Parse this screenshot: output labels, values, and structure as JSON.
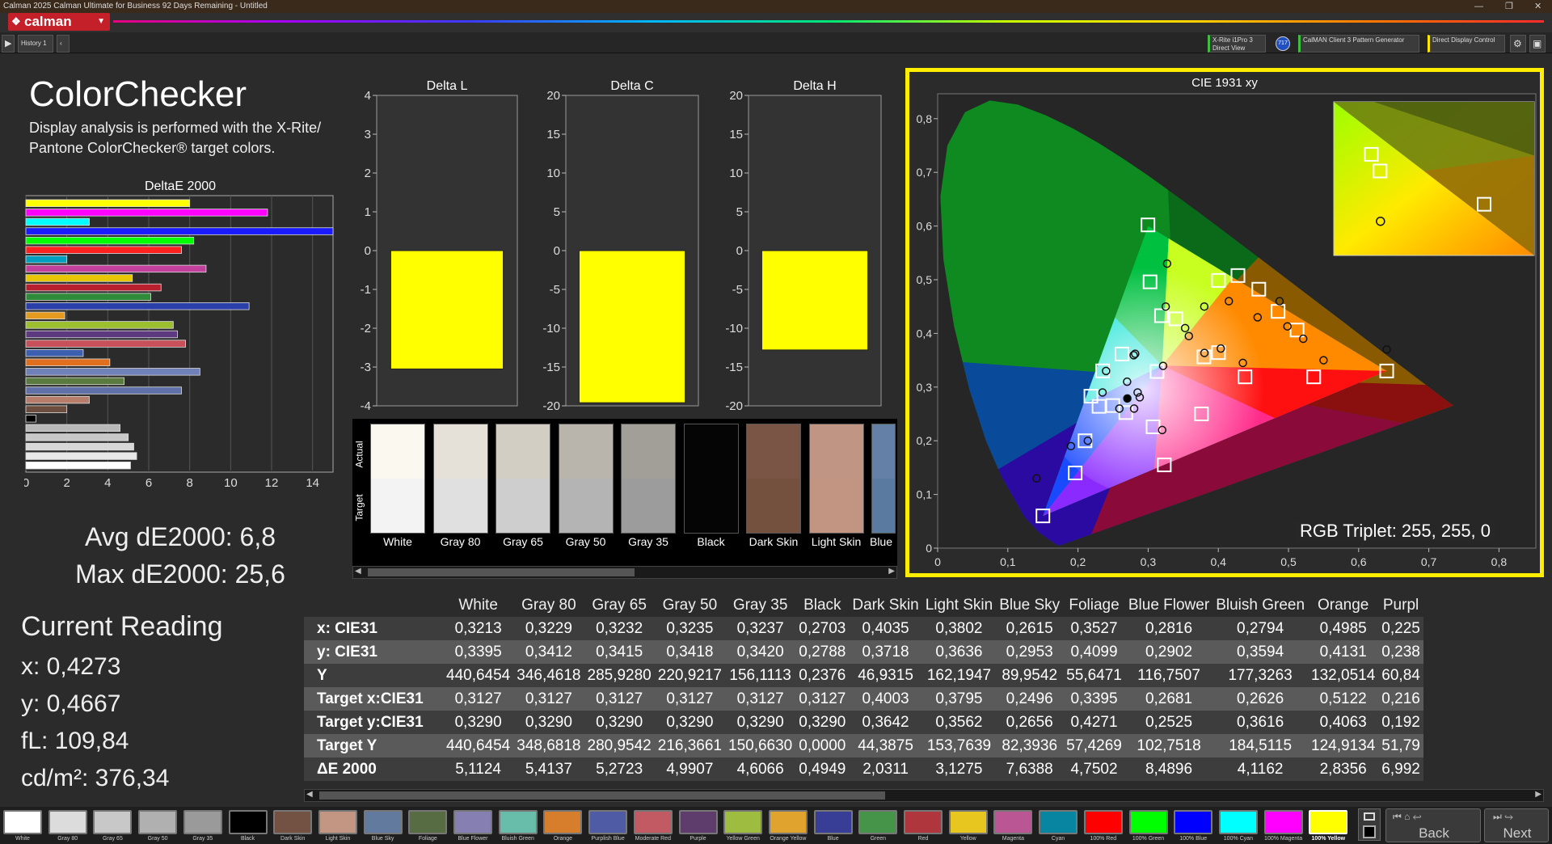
{
  "window": {
    "title": "Calman 2025 Calman Ultimate for Business 92 Days Remaining  - Untitled"
  },
  "logo": {
    "text": "calman"
  },
  "toolbar": {
    "history_label": "History 1",
    "device1": "X-Rite i1Pro 3\nDirect View",
    "device1_badge": "717",
    "device2": "CalMAN Client 3 Pattern Generator",
    "device3": "Direct Display Control"
  },
  "page": {
    "title": "ColorChecker",
    "subtitle_line1": "Display analysis is performed with the X-Rite/",
    "subtitle_line2": "Pantone ColorChecker® target colors."
  },
  "stats": {
    "avg": "Avg dE2000: 6,8",
    "max": "Max dE2000: 25,6"
  },
  "reading": {
    "title": "Current Reading",
    "x": "x: 0,4273",
    "y": "y: 0,4667",
    "fl": "fL: 109,84",
    "cdm": "cd/m²: 376,34"
  },
  "deltaE_chart": {
    "title": "DeltaE 2000",
    "ticks": [
      "0",
      "2",
      "4",
      "6",
      "8",
      "10",
      "12",
      "14"
    ],
    "xlim": [
      0,
      15
    ],
    "bars": [
      {
        "v": 8.0,
        "c": "#ffff00"
      },
      {
        "v": 11.8,
        "c": "#ff00ff"
      },
      {
        "v": 3.1,
        "c": "#00ffff"
      },
      {
        "v": 25.6,
        "c": "#1a1aff"
      },
      {
        "v": 8.2,
        "c": "#00ff00"
      },
      {
        "v": 7.6,
        "c": "#ff2020"
      },
      {
        "v": 2.0,
        "c": "#009fbf"
      },
      {
        "v": 8.8,
        "c": "#c0409b"
      },
      {
        "v": 5.2,
        "c": "#e8c600"
      },
      {
        "v": 6.6,
        "c": "#b8202f"
      },
      {
        "v": 6.1,
        "c": "#2e8b3a"
      },
      {
        "v": 10.9,
        "c": "#2a3fa8"
      },
      {
        "v": 1.9,
        "c": "#e59a20"
      },
      {
        "v": 7.2,
        "c": "#9cbf30"
      },
      {
        "v": 7.4,
        "c": "#5d3a80"
      },
      {
        "v": 7.8,
        "c": "#c8505a"
      },
      {
        "v": 2.8,
        "c": "#3d5fb0"
      },
      {
        "v": 4.1,
        "c": "#e07020"
      },
      {
        "v": 8.5,
        "c": "#7080b8"
      },
      {
        "v": 4.8,
        "c": "#5a7a40"
      },
      {
        "v": 7.6,
        "c": "#6070a8"
      },
      {
        "v": 3.1,
        "c": "#b67e6a"
      },
      {
        "v": 2.0,
        "c": "#6d4d3d"
      },
      {
        "v": 0.49,
        "c": "#000000"
      },
      {
        "v": 4.6,
        "c": "#b8b8b8"
      },
      {
        "v": 5.0,
        "c": "#c8c8c8"
      },
      {
        "v": 5.27,
        "c": "#d8d8d8"
      },
      {
        "v": 5.41,
        "c": "#e8e8e8"
      },
      {
        "v": 5.11,
        "c": "#ffffff"
      }
    ]
  },
  "delta_charts": [
    {
      "title": "Delta L",
      "ticks": [
        "4",
        "3",
        "2",
        "1",
        "0",
        "-1",
        "-2",
        "-3",
        "-4"
      ],
      "min": -4,
      "max": 4,
      "value": -3.05
    },
    {
      "title": "Delta C",
      "ticks": [
        "20",
        "15",
        "10",
        "5",
        "0",
        "-5",
        "-10",
        "-15",
        "-20"
      ],
      "min": -20,
      "max": 20,
      "value": -19.6
    },
    {
      "title": "Delta H",
      "ticks": [
        "20",
        "15",
        "10",
        "5",
        "0",
        "-5",
        "-10",
        "-15",
        "-20"
      ],
      "min": -20,
      "max": 20,
      "value": -12.8
    }
  ],
  "swatches": {
    "actual_label": "Actual",
    "target_label": "Target",
    "items": [
      {
        "name": "White",
        "actual": "#fbf8ef",
        "target": "#f3f3f3"
      },
      {
        "name": "Gray 80",
        "actual": "#e5e0d8",
        "target": "#e0e0e0"
      },
      {
        "name": "Gray 65",
        "actual": "#d2cec4",
        "target": "#cecece"
      },
      {
        "name": "Gray 50",
        "actual": "#b9b5ad",
        "target": "#b4b4b4"
      },
      {
        "name": "Gray 35",
        "actual": "#a29f98",
        "target": "#9c9c9c"
      },
      {
        "name": "Black",
        "actual": "#050505",
        "target": "#050505"
      },
      {
        "name": "Dark Skin",
        "actual": "#7a5445",
        "target": "#74503f"
      },
      {
        "name": "Light Skin",
        "actual": "#c09584",
        "target": "#c29482"
      },
      {
        "name": "Blue",
        "actual": "#6580a6",
        "target": "#5b7aa0"
      }
    ]
  },
  "cie": {
    "title": "CIE 1931 xy",
    "x_ticks": [
      "0",
      "0,1",
      "0,2",
      "0,3",
      "0,4",
      "0,5",
      "0,6",
      "0,7",
      "0,8"
    ],
    "y_ticks": [
      "0,8",
      "0,7",
      "0,6",
      "0,5",
      "0,4",
      "0,3",
      "0,2",
      "0,1",
      "0"
    ],
    "rgb_triplet": "RGB Triplet: 255, 255, 0",
    "targets": [
      [
        0.2997,
        0.6021
      ],
      [
        0.3027,
        0.496
      ],
      [
        0.4003,
        0.4987
      ],
      [
        0.428,
        0.5078
      ],
      [
        0.4577,
        0.4823
      ],
      [
        0.4852,
        0.441
      ],
      [
        0.5122,
        0.4063
      ],
      [
        0.3395,
        0.4271
      ],
      [
        0.319,
        0.433
      ],
      [
        0.2626,
        0.3616
      ],
      [
        0.2496,
        0.2656
      ],
      [
        0.235,
        0.3302
      ],
      [
        0.2184,
        0.283
      ],
      [
        0.23,
        0.2641
      ],
      [
        0.2681,
        0.2525
      ],
      [
        0.3127,
        0.329
      ],
      [
        0.4003,
        0.3642
      ],
      [
        0.3795,
        0.3562
      ],
      [
        0.438,
        0.319
      ],
      [
        0.536,
        0.319
      ],
      [
        0.64,
        0.33
      ],
      [
        0.15,
        0.06
      ],
      [
        0.196,
        0.14
      ],
      [
        0.21,
        0.2
      ],
      [
        0.307,
        0.226
      ],
      [
        0.376,
        0.25
      ],
      [
        0.323,
        0.155
      ]
    ],
    "measured": [
      [
        0.3213,
        0.3395
      ],
      [
        0.2703,
        0.2788
      ],
      [
        0.3527,
        0.4099
      ],
      [
        0.2815,
        0.362
      ],
      [
        0.327,
        0.53
      ],
      [
        0.325,
        0.45
      ],
      [
        0.38,
        0.45
      ],
      [
        0.415,
        0.46
      ],
      [
        0.456,
        0.43
      ],
      [
        0.4873,
        0.46
      ],
      [
        0.4985,
        0.4131
      ],
      [
        0.358,
        0.395
      ],
      [
        0.24,
        0.33
      ],
      [
        0.235,
        0.29
      ],
      [
        0.2794,
        0.3594
      ],
      [
        0.27,
        0.31
      ],
      [
        0.285,
        0.29
      ],
      [
        0.4035,
        0.3718
      ],
      [
        0.3802,
        0.3636
      ],
      [
        0.435,
        0.345
      ],
      [
        0.521,
        0.39
      ],
      [
        0.55,
        0.35
      ],
      [
        0.64,
        0.37
      ],
      [
        0.141,
        0.13
      ],
      [
        0.19,
        0.19
      ],
      [
        0.214,
        0.2
      ],
      [
        0.259,
        0.26
      ],
      [
        0.288,
        0.281
      ],
      [
        0.28,
        0.26
      ],
      [
        0.32,
        0.22
      ]
    ],
    "inset_targets": [
      [
        0.42,
        0.519
      ],
      [
        0.51,
        0.48
      ],
      [
        0.427,
        0.506
      ]
    ],
    "inset_measured": [
      [
        0.4273,
        0.4667
      ]
    ]
  },
  "table": {
    "columns": [
      "White",
      "Gray 80",
      "Gray 65",
      "Gray 50",
      "Gray 35",
      "Black",
      "Dark Skin",
      "Light Skin",
      "Blue Sky",
      "Foliage",
      "Blue Flower",
      "Bluish Green",
      "Orange",
      "Purpl"
    ],
    "rows": [
      {
        "label": "x: CIE31",
        "cells": [
          "0,3213",
          "0,3229",
          "0,3232",
          "0,3235",
          "0,3237",
          "0,2703",
          "0,4035",
          "0,3802",
          "0,2615",
          "0,3527",
          "0,2816",
          "0,2794",
          "0,4985",
          "0,225"
        ]
      },
      {
        "label": "y: CIE31",
        "cells": [
          "0,3395",
          "0,3412",
          "0,3415",
          "0,3418",
          "0,3420",
          "0,2788",
          "0,3718",
          "0,3636",
          "0,2953",
          "0,4099",
          "0,2902",
          "0,3594",
          "0,4131",
          "0,238"
        ]
      },
      {
        "label": "Y",
        "cells": [
          "440,6454",
          "346,4618",
          "285,9280",
          "220,9217",
          "156,1113",
          "0,2376",
          "46,9315",
          "162,1947",
          "89,9542",
          "55,6471",
          "116,7507",
          "177,3263",
          "132,0514",
          "60,84"
        ]
      },
      {
        "label": "Target x:CIE31",
        "cells": [
          "0,3127",
          "0,3127",
          "0,3127",
          "0,3127",
          "0,3127",
          "0,3127",
          "0,4003",
          "0,3795",
          "0,2496",
          "0,3395",
          "0,2681",
          "0,2626",
          "0,5122",
          "0,216"
        ]
      },
      {
        "label": "Target y:CIE31",
        "cells": [
          "0,3290",
          "0,3290",
          "0,3290",
          "0,3290",
          "0,3290",
          "0,3290",
          "0,3642",
          "0,3562",
          "0,2656",
          "0,4271",
          "0,2525",
          "0,3616",
          "0,4063",
          "0,192"
        ]
      },
      {
        "label": "Target Y",
        "cells": [
          "440,6454",
          "348,6818",
          "280,9542",
          "216,3661",
          "150,6630",
          "0,0000",
          "44,3875",
          "153,7639",
          "82,3936",
          "57,4269",
          "102,7518",
          "184,5115",
          "124,9134",
          "51,79"
        ]
      },
      {
        "label": "ΔE 2000",
        "cells": [
          "5,1124",
          "5,4137",
          "5,2723",
          "4,9907",
          "4,6066",
          "0,4949",
          "2,0311",
          "3,1275",
          "7,6388",
          "4,7502",
          "8,4896",
          "4,1162",
          "2,8356",
          "6,992"
        ]
      }
    ]
  },
  "patches": [
    {
      "label": "White",
      "c": "#ffffff"
    },
    {
      "label": "Gray 80",
      "c": "#dcdcdc"
    },
    {
      "label": "Gray 65",
      "c": "#c8c8c8"
    },
    {
      "label": "Gray 50",
      "c": "#b0b0b0"
    },
    {
      "label": "Gray 35",
      "c": "#9a9a9a"
    },
    {
      "label": "Black",
      "c": "#000000"
    },
    {
      "label": "Dark Skin",
      "c": "#735244"
    },
    {
      "label": "Light Skin",
      "c": "#c29682"
    },
    {
      "label": "Blue Sky",
      "c": "#627a9d"
    },
    {
      "label": "Foliage",
      "c": "#576c43"
    },
    {
      "label": "Blue Flower",
      "c": "#8580b1"
    },
    {
      "label": "Bluish Green",
      "c": "#67bdaa"
    },
    {
      "label": "Orange",
      "c": "#d67e2c"
    },
    {
      "label": "Purplish Blue",
      "c": "#505ba6"
    },
    {
      "label": "Moderate Red",
      "c": "#c15a63"
    },
    {
      "label": "Purple",
      "c": "#5e3c6c"
    },
    {
      "label": "Yellow Green",
      "c": "#9dbc40"
    },
    {
      "label": "Orange Yellow",
      "c": "#e0a32e"
    },
    {
      "label": "Blue",
      "c": "#383d96"
    },
    {
      "label": "Green",
      "c": "#469449"
    },
    {
      "label": "Red",
      "c": "#af363c"
    },
    {
      "label": "Yellow",
      "c": "#e7c71f"
    },
    {
      "label": "Magenta",
      "c": "#bb5695"
    },
    {
      "label": "Cyan",
      "c": "#0885a1"
    },
    {
      "label": "100% Red",
      "c": "#ff0000"
    },
    {
      "label": "100% Green",
      "c": "#00ff00"
    },
    {
      "label": "100% Blue",
      "c": "#0000ff"
    },
    {
      "label": "100% Cyan",
      "c": "#00ffff"
    },
    {
      "label": "100% Magenta",
      "c": "#ff00ff"
    },
    {
      "label": "100% Yellow",
      "c": "#ffff00"
    }
  ],
  "nav": {
    "back": "Back",
    "next": "Next"
  }
}
